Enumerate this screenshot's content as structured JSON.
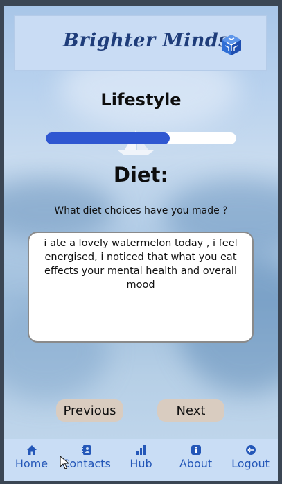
{
  "header": {
    "brand": "Brighter Minds",
    "logo_icon": "cube-logo-icon"
  },
  "section": {
    "title": "Lifestyle"
  },
  "progress": {
    "fraction": 0.65
  },
  "topic": {
    "title": "Diet:"
  },
  "question": {
    "text": "What diet choices have you made ?"
  },
  "answer": {
    "value": "i ate a lovely watermelon today , i feel energised, i noticed that what you eat effects your mental health and overall mood"
  },
  "buttons": {
    "previous": "Previous",
    "next": "Next"
  },
  "nav": {
    "items": [
      {
        "label": "Home",
        "icon": "home-icon"
      },
      {
        "label": "Contacts",
        "icon": "contacts-icon"
      },
      {
        "label": "Hub",
        "icon": "hub-icon"
      },
      {
        "label": "About",
        "icon": "info-icon"
      },
      {
        "label": "Logout",
        "icon": "logout-icon"
      }
    ]
  },
  "colors": {
    "accent": "#2f57d1",
    "nav_text": "#2457b8",
    "brand": "#1f3d7a"
  }
}
